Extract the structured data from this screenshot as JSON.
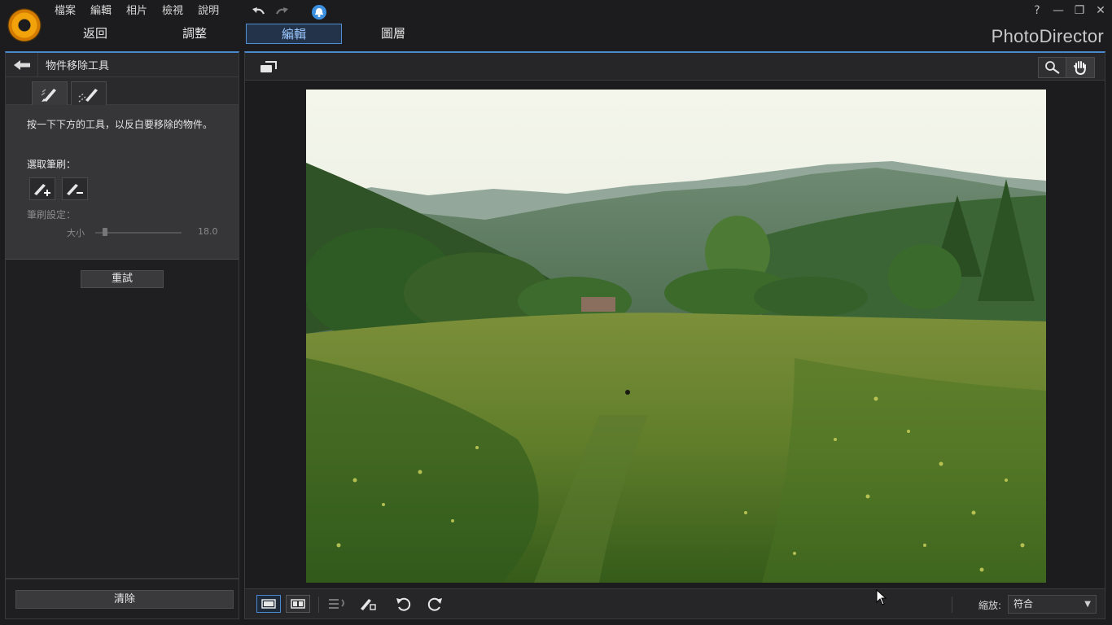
{
  "menu": [
    "檔案",
    "編輯",
    "相片",
    "檢視",
    "說明"
  ],
  "window_controls": [
    "?",
    "—",
    "❐",
    "✕"
  ],
  "mode_tabs": [
    {
      "label": "返回",
      "active": false
    },
    {
      "label": "調整",
      "active": false
    },
    {
      "label": "編輯",
      "active": true
    },
    {
      "label": "圖層",
      "active": false
    }
  ],
  "brand": "PhotoDirector",
  "panel": {
    "title": "物件移除工具",
    "hint": "按一下下方的工具，以反白要移除的物件。",
    "brush_select_label": "選取筆刷：",
    "brush_settings_label": "筆刷設定：",
    "size_label": "大小",
    "size_value": "18.0",
    "size_fraction": 0.11,
    "retry_label": "重試",
    "clear_label": "清除"
  },
  "zoom": {
    "label": "縮放:",
    "value": "符合"
  },
  "colors": {
    "accent": "#4a89d0",
    "logo": "#f2a20a",
    "notify": "#3d8fe0"
  },
  "icons": {
    "back": "left-arrow-icon",
    "undo": "undo-icon",
    "redo": "redo-icon",
    "notification": "bell-icon",
    "magnifier": "magnifier-icon",
    "hand": "hand-icon"
  }
}
